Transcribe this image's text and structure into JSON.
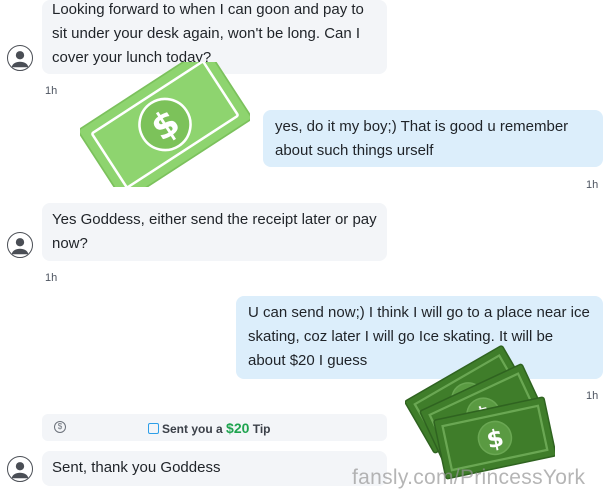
{
  "messages": [
    {
      "text": "Looking forward to when I can goon and pay to sit under your desk again, won't be long. Can I cover your lunch today?",
      "time": "1h"
    },
    {
      "text": "yes, do it my boy;) That is good u remember about such things urself",
      "time": "1h"
    },
    {
      "text": "Yes Goddess, either send the receipt later or pay now?",
      "time": "1h"
    },
    {
      "text": "U can send now;) I think I will go to a place near ice skating, coz later I will go Ice skating. It will be about $20 I guess",
      "time": "1h"
    },
    {
      "text": "Sent, thank you Goddess"
    }
  ],
  "tip": {
    "prefix": "Sent you a",
    "amount": "$20",
    "suffix": "Tip",
    "coin_icon": "$"
  },
  "watermark": "fansly.com/PrincessYork",
  "colors": {
    "incoming": "#f3f5f8",
    "outgoing": "#dceefb",
    "tip_amount": "#1fa44f",
    "money_light": "#8ed46f",
    "money_dark": "#3f7d2a"
  }
}
